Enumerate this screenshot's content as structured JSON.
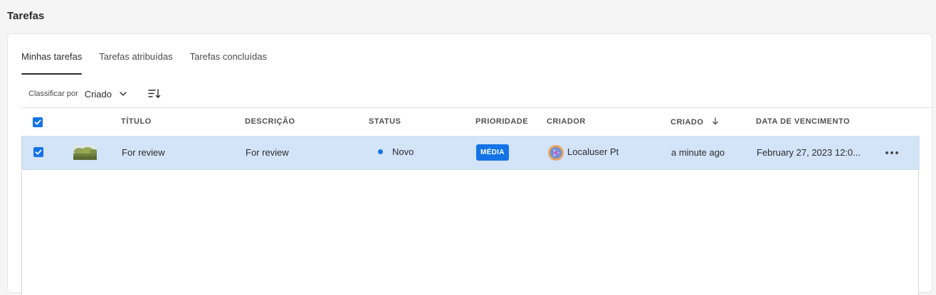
{
  "page": {
    "title": "Tarefas"
  },
  "tabs": [
    {
      "label": "Minhas tarefas",
      "active": true
    },
    {
      "label": "Tarefas atribuídas",
      "active": false
    },
    {
      "label": "Tarefas concluídas",
      "active": false
    }
  ],
  "sort": {
    "label": "Classificar por",
    "selected": "Criado",
    "chevron_icon": "chevron-down-icon",
    "order_icon": "sort-order-icon"
  },
  "table": {
    "columns": [
      "TÍTULO",
      "DESCRIÇÃO",
      "STATUS",
      "PRIORIDADE",
      "CRIADOR",
      "CRIADO",
      "DATA DE VENCIMENTO"
    ],
    "sorted_column": "CRIADO",
    "select_all_checked": true,
    "rows": [
      {
        "selected": true,
        "title": "For review",
        "description": "For review",
        "status": "Novo",
        "priority": "MÉDIA",
        "creator": "Localuser Pt",
        "created": "a minute ago",
        "due_date": "February 27, 2023 12:0..."
      }
    ]
  },
  "colors": {
    "accent": "#1473e6",
    "row_selected": "#d3e3f8",
    "background": "#f5f5f5"
  }
}
